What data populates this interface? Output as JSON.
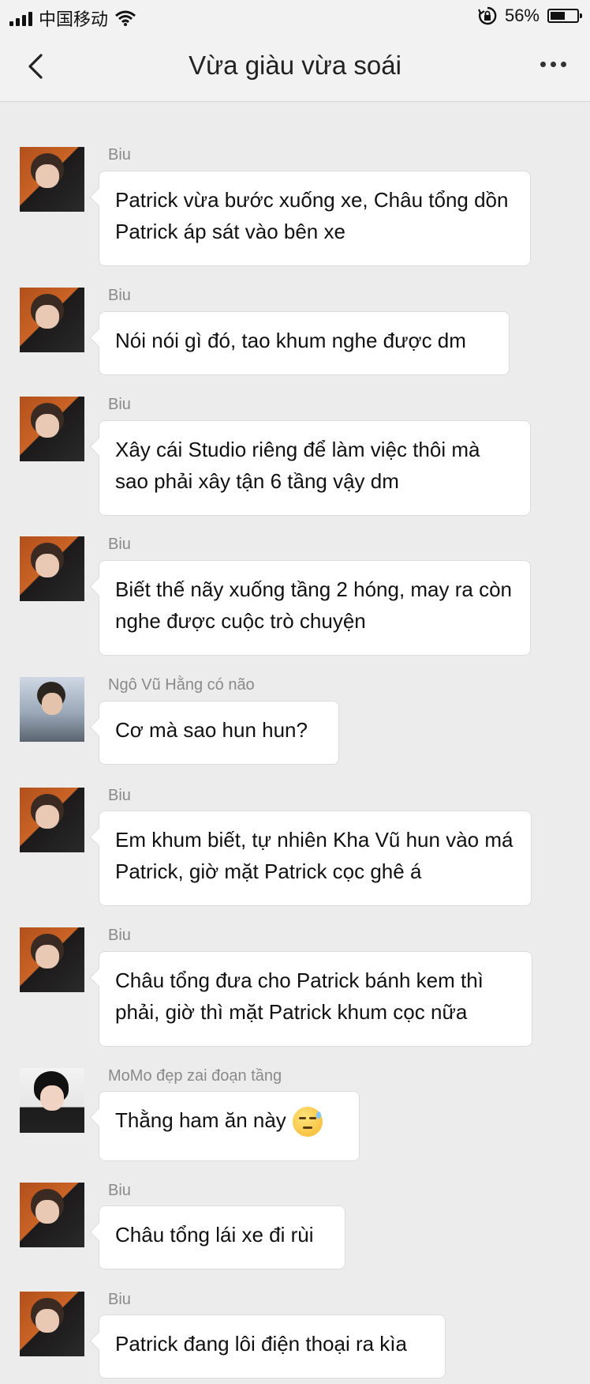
{
  "status_bar": {
    "carrier": "中国移动",
    "battery_percent": "56%",
    "battery_level": 0.56,
    "icons": [
      "signal-icon",
      "wifi-icon",
      "rotation-lock-icon",
      "battery-icon"
    ]
  },
  "header": {
    "title": "Vừa giàu vừa soái",
    "icons": [
      "back-icon",
      "more-icon"
    ]
  },
  "messages": [
    {
      "sender": "Biu",
      "text": "Patrick vừa bước xuống xe, Châu tổng dồn Patrick áp sát vào bên xe"
    },
    {
      "sender": "Biu",
      "text": "Nói nói gì đó, tao khum nghe được dm"
    },
    {
      "sender": "Biu",
      "text": "Xây cái Studio riêng để làm việc thôi mà sao phải xây tận 6 tầng vậy dm"
    },
    {
      "sender": "Biu",
      "text": "Biết thế nãy xuống tầng  2 hóng, may ra còn nghe được cuộc trò chuyện"
    },
    {
      "sender": "Ngô Vũ Hằng có não",
      "text": "Cơ mà sao hun hun?"
    },
    {
      "sender": "Biu",
      "text": "Em khum biết, tự nhiên Kha Vũ hun vào má Patrick, giờ mặt Patrick cọc ghê á"
    },
    {
      "sender": "Biu",
      "text": "Châu tổng đưa cho Patrick bánh kem thì phải, giờ thì mặt Patrick khum cọc nữa"
    },
    {
      "sender": "MoMo đẹp zai đoạn tầng",
      "text": "Thằng ham ăn này",
      "emoji": "sweat-smile-emoji"
    },
    {
      "sender": "Biu",
      "text": "Châu tổng lái xe đi rùi"
    },
    {
      "sender": "Biu",
      "text": "Patrick đang lôi điện thoại ra kìa"
    }
  ]
}
